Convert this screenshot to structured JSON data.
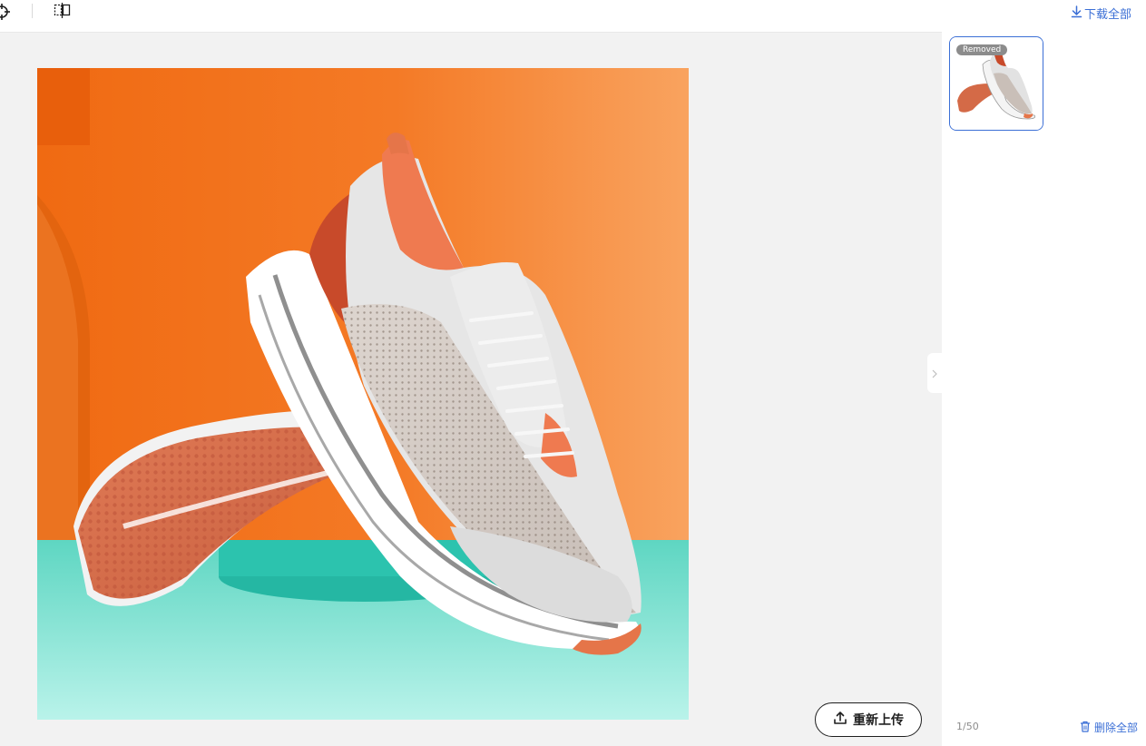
{
  "toolbar": {
    "tools": [
      "crosshair-icon",
      "compare-icon"
    ]
  },
  "canvas": {
    "reupload_label": "重新上传",
    "reupload_icon": "upload-icon",
    "toggle_icon": "chevron-right-icon"
  },
  "side_panel": {
    "download_all_label": "下载全部",
    "download_icon": "download-icon",
    "thumbnail_badge": "Removed",
    "page_count": "1/50",
    "delete_all_label": "删除全部",
    "delete_icon": "trash-icon"
  },
  "colors": {
    "accent": "#3b6fd6",
    "canvas_bg": "#f2f2f2",
    "button_border": "#1f1f1f",
    "badge_bg": "#8c8c8c"
  }
}
